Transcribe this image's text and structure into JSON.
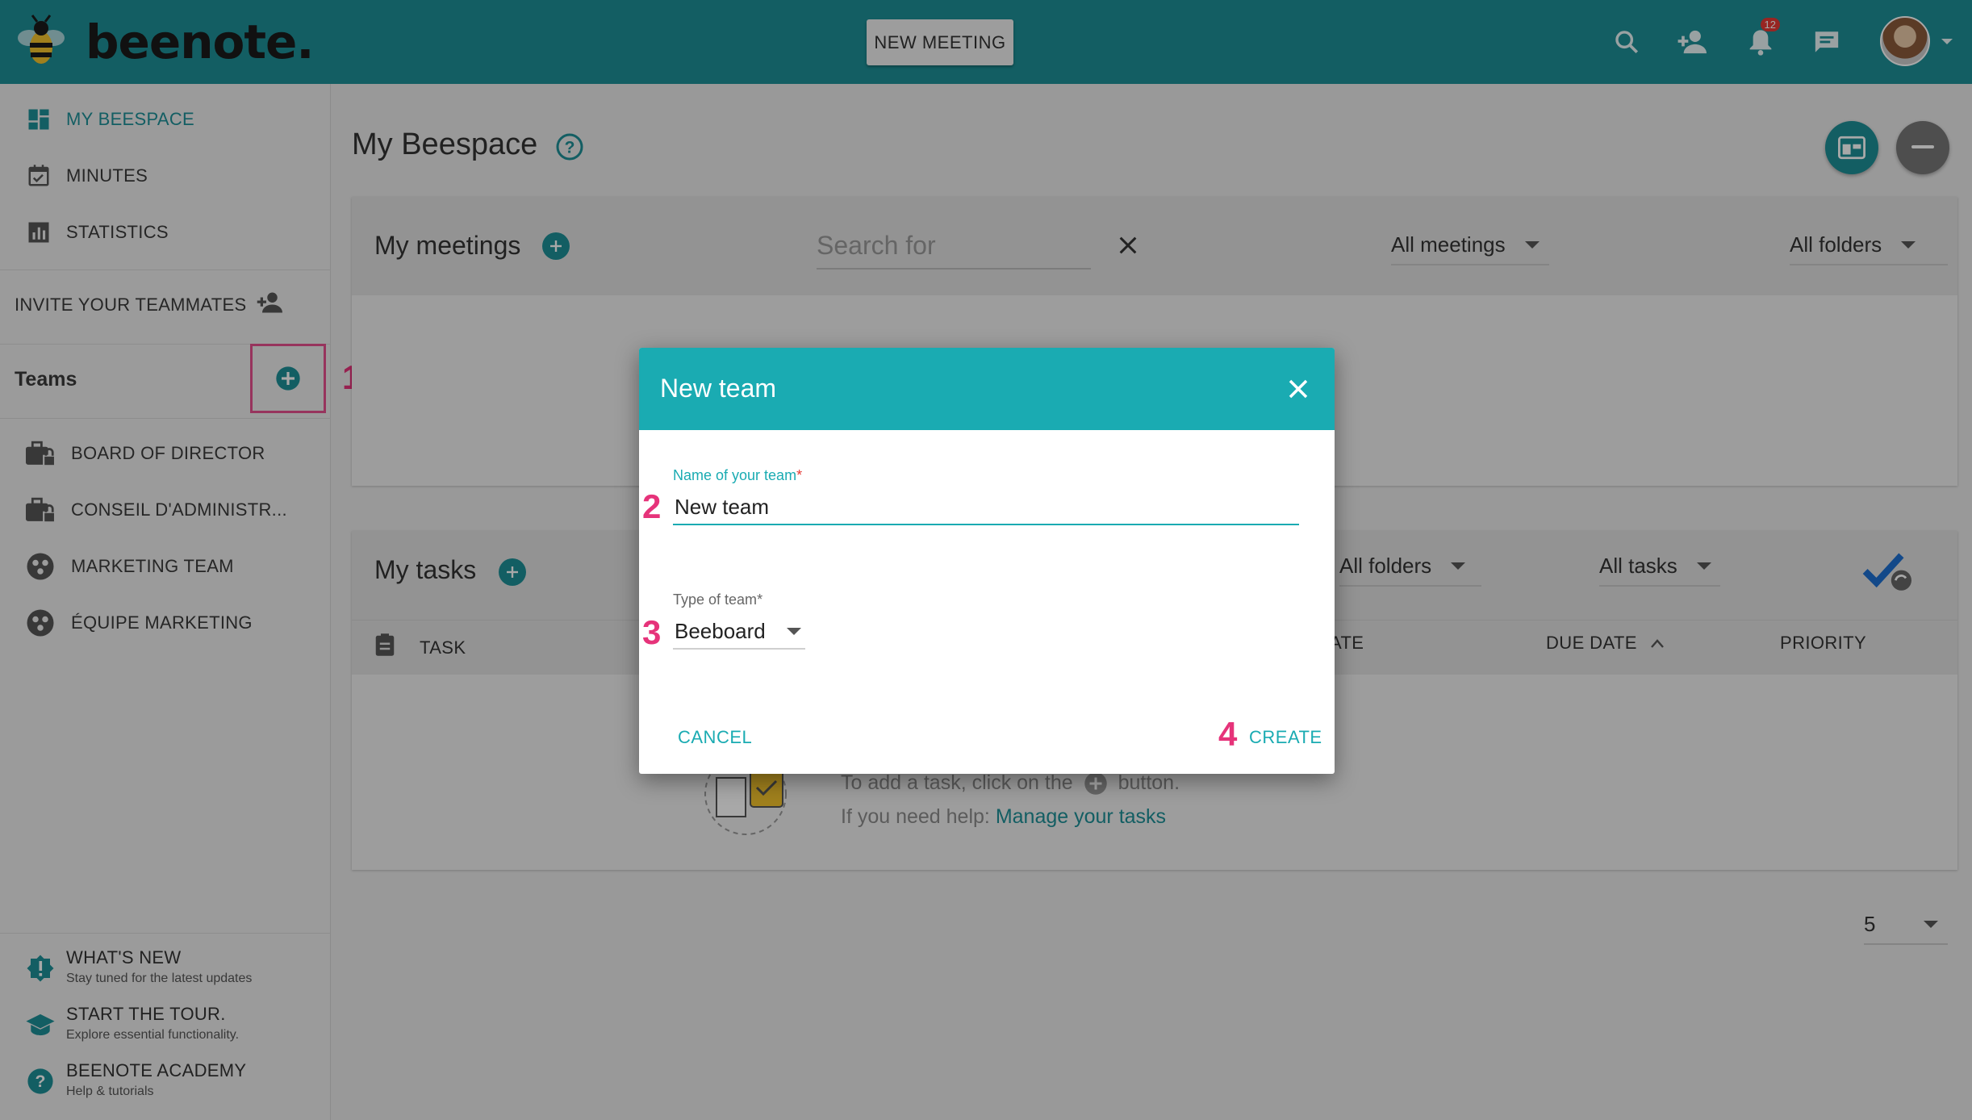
{
  "app": {
    "logo_text": "beenote."
  },
  "topbar": {
    "new_meeting_label": "NEW MEETING",
    "notification_count": "12",
    "icons": [
      "search-icon",
      "add-person-icon",
      "bell-icon",
      "chat-icon",
      "chevron-down-icon"
    ]
  },
  "colors": {
    "primary": "#1d8f96",
    "dialog_header": "#1aabb2",
    "annotation": "#e6337a"
  },
  "sidebar": {
    "nav": [
      {
        "label": "MY BEESPACE",
        "icon": "dashboard-icon",
        "active": true
      },
      {
        "label": "MINUTES",
        "icon": "calendar-check-icon"
      },
      {
        "label": "STATISTICS",
        "icon": "bar-chart-icon"
      }
    ],
    "invite_label": "INVITE YOUR TEAMMATES",
    "teams_label": "Teams",
    "teams": [
      {
        "label": "BOARD OF DIRECTOR",
        "icon": "briefcase-lock-icon"
      },
      {
        "label": "CONSEIL D'ADMINISTR...",
        "icon": "briefcase-lock-icon"
      },
      {
        "label": "MARKETING TEAM",
        "icon": "group-icon"
      },
      {
        "label": "ÉQUIPE MARKETING",
        "icon": "group-icon"
      }
    ],
    "footer": [
      {
        "title": "WHAT'S NEW",
        "subtitle": "Stay tuned for the latest updates",
        "icon": "new-badge-icon"
      },
      {
        "title": "START THE TOUR.",
        "subtitle": "Explore essential functionality.",
        "icon": "graduation-cap-icon"
      },
      {
        "title": "BEENOTE ACADEMY",
        "subtitle": "Help & tutorials",
        "icon": "help-icon"
      }
    ]
  },
  "annotations": [
    "1",
    "2",
    "3",
    "4"
  ],
  "main": {
    "title": "My Beespace",
    "meetings": {
      "title": "My meetings",
      "search_placeholder": "Search for",
      "filter_meetings": "All meetings",
      "filter_folders": "All folders"
    },
    "tasks": {
      "title": "My tasks",
      "filter_folders": "All folders",
      "filter_tasks": "All tasks",
      "columns": [
        "TASK",
        "ATE",
        "DUE DATE",
        "PRIORITY"
      ],
      "empty_line1_prefix": "To add a task, click on the",
      "empty_line1_suffix": "button.",
      "empty_line2_prefix": "If you need help:",
      "empty_link": "Manage your tasks"
    },
    "page_size": "5"
  },
  "dialog": {
    "title": "New team",
    "name_label": "Name of your team",
    "name_value": "New team",
    "type_label": "Type of team",
    "type_value": "Beeboard",
    "required_mark": "*",
    "cancel_label": "CANCEL",
    "create_label": "CREATE"
  }
}
